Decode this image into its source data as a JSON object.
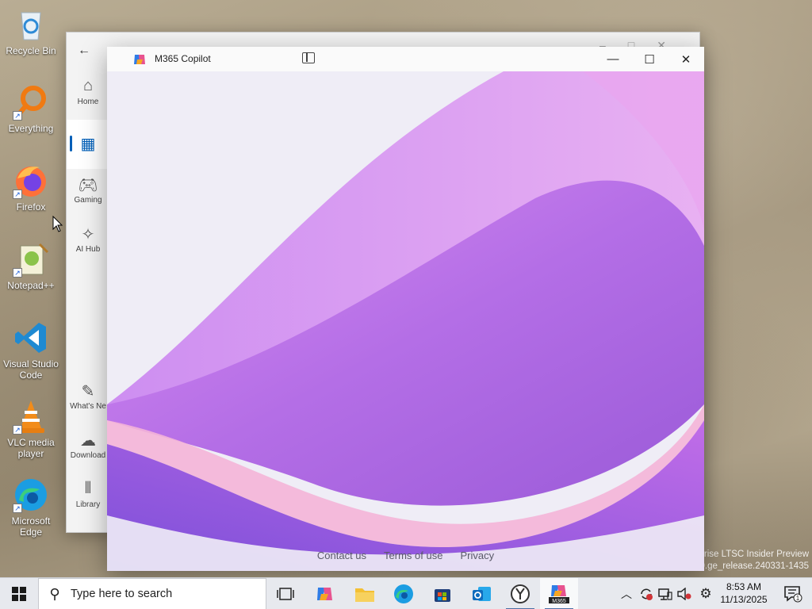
{
  "desktop": {
    "icons": [
      {
        "label": "Recycle Bin",
        "icon": "recycle-bin-icon"
      },
      {
        "label": "Everything",
        "icon": "everything-search-icon"
      },
      {
        "label": "Firefox",
        "icon": "firefox-icon"
      },
      {
        "label": "Notepad++",
        "icon": "notepad-plus-plus-icon"
      },
      {
        "label": "Visual Studio Code",
        "icon": "vscode-icon"
      },
      {
        "label": "VLC media player",
        "icon": "vlc-icon"
      },
      {
        "label": "Microsoft Edge",
        "icon": "edge-icon"
      }
    ],
    "watermark_line1": "rise LTSC Insider Preview",
    "watermark_line2": "0.ge_release.240331-1435"
  },
  "store_window": {
    "nav": [
      {
        "label": "Home",
        "icon": "home-icon"
      },
      {
        "label": "",
        "icon": "apps-icon"
      },
      {
        "label": "Gaming",
        "icon": "gamepad-icon"
      },
      {
        "label": "AI Hub",
        "icon": "sparkle-icon"
      },
      {
        "label": "What's Ne",
        "icon": "whats-new-icon"
      },
      {
        "label": "Download",
        "icon": "download-icon"
      },
      {
        "label": "Library",
        "icon": "library-icon"
      }
    ]
  },
  "copilot_window": {
    "title": "M365 Copilot",
    "footer_links": [
      "Contact us",
      "Terms of use",
      "Privacy"
    ]
  },
  "taskbar": {
    "search_placeholder": "Type here to search",
    "apps": [
      "task-view-icon",
      "copilot-icon",
      "file-explorer-icon",
      "edge-icon",
      "microsoft-store-icon",
      "outlook-icon",
      "clock-app-icon",
      "m365-icon"
    ],
    "m365_badge": "M365",
    "clock_time": "8:53 AM",
    "clock_date": "11/13/2025",
    "notification_count": "1"
  }
}
